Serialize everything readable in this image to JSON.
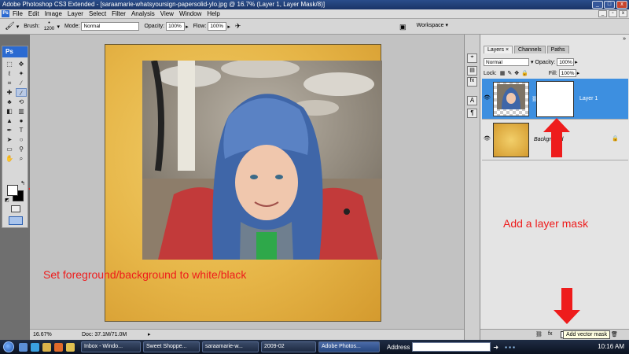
{
  "window": {
    "title": "Adobe Photoshop CS3 Extended - [saraamarie-whatsyoursign-papersolid-ylo.jpg @ 16.7% (Layer 1, Layer Mask/8)]"
  },
  "menu": [
    "File",
    "Edit",
    "Image",
    "Layer",
    "Select",
    "Filter",
    "Analysis",
    "View",
    "Window",
    "Help"
  ],
  "options_bar": {
    "brush_label": "Brush:",
    "brush_size": "1200",
    "mode_label": "Mode:",
    "mode_value": "Normal",
    "opacity_label": "Opacity:",
    "opacity_value": "100%",
    "flow_label": "Flow:",
    "flow_value": "100%",
    "workspace_label": "Workspace"
  },
  "toolbox": {
    "logo": "Ps"
  },
  "status_bar": {
    "zoom": "16.67%",
    "doc_info": "Doc: 37.1M/71.0M"
  },
  "layers_panel": {
    "tabs": [
      "Layers ×",
      "Channels",
      "Paths"
    ],
    "blend_mode": "Normal",
    "opacity_label": "Opacity:",
    "opacity_value": "100%",
    "lock_label": "Lock:",
    "fill_label": "Fill:",
    "fill_value": "100%",
    "layers": [
      {
        "name": "Layer 1",
        "selected": true
      },
      {
        "name": "Background",
        "selected": false
      }
    ],
    "tooltip": "Add vector mask"
  },
  "annotations": {
    "left_note": "Set foreground/background to white/black",
    "right_note": "Add a layer mask",
    "color": "#ee1c1c"
  },
  "taskbar": {
    "tasks": [
      "Inbox - Windo...",
      "Sweet Shoppe...",
      "saraamarie-w...",
      "2009-02",
      "Adobe Photos..."
    ],
    "address_label": "Address",
    "clock": "10:16 AM"
  },
  "colors": {
    "selected_layer": "#3d8fe0",
    "paper": "#e6b547"
  }
}
